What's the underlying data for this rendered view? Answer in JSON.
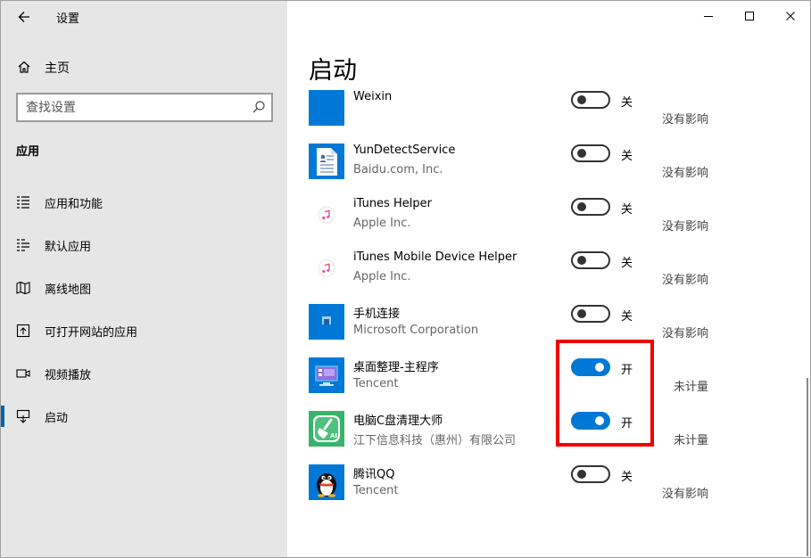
{
  "window": {
    "title": "设置",
    "controls": [
      "minimize-icon",
      "maximize-icon",
      "close-icon"
    ]
  },
  "sidebar": {
    "home_label": "主页",
    "search": {
      "placeholder": "查找设置"
    },
    "section_title": "应用",
    "items": [
      {
        "label": "应用和功能",
        "icon": "list-icon"
      },
      {
        "label": "默认应用",
        "icon": "default-apps-icon"
      },
      {
        "label": "离线地图",
        "icon": "map-icon"
      },
      {
        "label": "可打开网站的应用",
        "icon": "open-web-icon"
      },
      {
        "label": "视频播放",
        "icon": "video-icon"
      },
      {
        "label": "启动",
        "icon": "startup-icon",
        "active": true
      }
    ]
  },
  "main": {
    "title": "启动",
    "apps": [
      {
        "name": "Weixin",
        "publisher": "",
        "enabled": false,
        "state": "关",
        "impact": "没有影响",
        "icon": "weixin-app-icon"
      },
      {
        "name": "YunDetectService",
        "publisher": "Baidu.com, Inc.",
        "enabled": false,
        "state": "关",
        "impact": "没有影响",
        "icon": "document-app-icon"
      },
      {
        "name": "iTunes Helper",
        "publisher": "Apple Inc.",
        "enabled": false,
        "state": "关",
        "impact": "没有影响",
        "icon": "itunes-icon"
      },
      {
        "name": "iTunes Mobile Device Helper",
        "publisher": "Apple Inc.",
        "enabled": false,
        "state": "关",
        "impact": "没有影响",
        "icon": "itunes-icon"
      },
      {
        "name": "手机连接",
        "publisher": "Microsoft Corporation",
        "enabled": false,
        "state": "关",
        "impact": "没有影响",
        "icon": "phone-link-icon"
      },
      {
        "name": "桌面整理-主程序",
        "publisher": "Tencent",
        "enabled": true,
        "state": "开",
        "impact": "未计量",
        "icon": "desktop-organizer-icon"
      },
      {
        "name": "电脑C盘清理大师",
        "publisher": "江下信息科技（惠州）有限公司",
        "enabled": true,
        "state": "开",
        "impact": "未计量",
        "icon": "cleaner-broom-icon"
      },
      {
        "name": "腾讯QQ",
        "publisher": "Tencent",
        "enabled": false,
        "state": "关",
        "impact": "没有影响",
        "icon": "qq-penguin-icon"
      }
    ]
  },
  "colors": {
    "accent": "#0078d7",
    "sidebar_bg": "#e6e6e6",
    "highlight": "#f10000"
  }
}
